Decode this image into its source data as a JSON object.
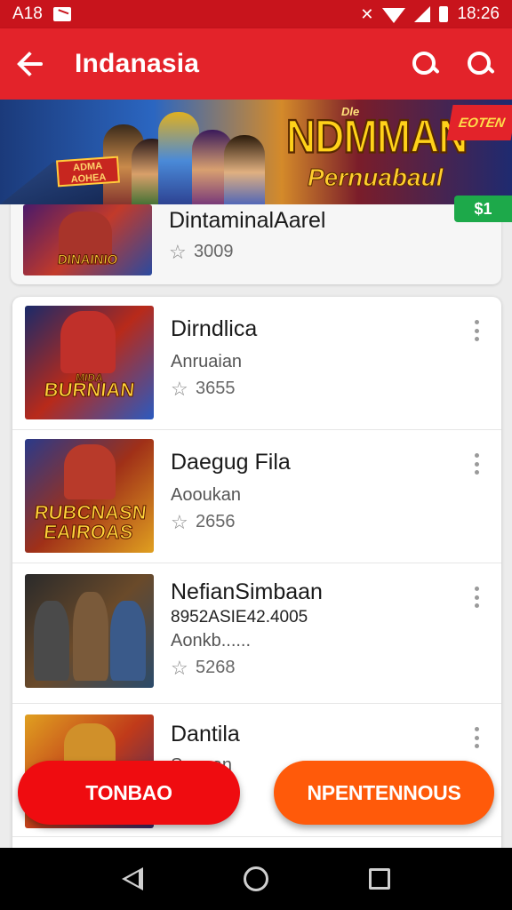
{
  "status_bar": {
    "carrier": "A18",
    "time": "18:26"
  },
  "app_bar": {
    "title": "Indanasia"
  },
  "banner": {
    "logo_main": "NDMMAN",
    "logo_sub": "Pernuabaul",
    "top_tag": "Dle",
    "small_tag": "ADMA AOHEA",
    "corner_tag": "EOTEN"
  },
  "badge": {
    "label": "$1"
  },
  "list": {
    "top_item": {
      "title": "DintaminalAarel",
      "rating": "3009",
      "thumb_text": "DINAINIO"
    },
    "items": [
      {
        "title": "Dirndlica",
        "subtitle": "Anruaian",
        "rating": "3655",
        "thumb_text": "BURNIAN",
        "thumb_sub": "MIDA"
      },
      {
        "title": "Daegug Fila",
        "subtitle": "Aooukan",
        "rating": "2656",
        "thumb_text": "RUBCNASN EAIROAS"
      },
      {
        "title": "NefianSimbaan",
        "extra": "8952ASIE42.4005",
        "subtitle": "Aonkb......",
        "rating": "5268"
      },
      {
        "title": "Dantila",
        "subtitle": "Suonan"
      }
    ]
  },
  "buttons": {
    "left": "TONBAO",
    "right": "NPENTENNOUS"
  },
  "colors": {
    "app_bar": "#e3232a",
    "status_bar": "#c8141c",
    "left_button": "#ef0c10",
    "right_button": "#ff5a0a",
    "badge": "#1da94a"
  }
}
